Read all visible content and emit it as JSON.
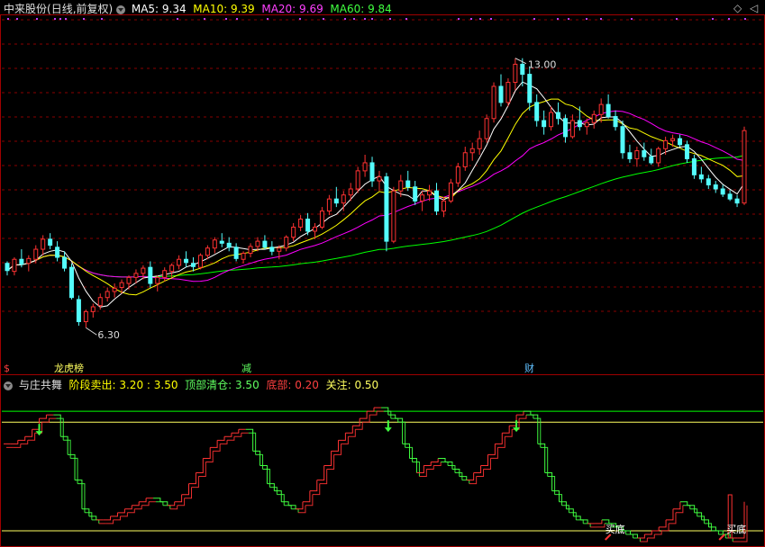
{
  "header": {
    "stock_name": "中来股份",
    "period_label": "(日线,前复权)",
    "ma5_label": "MA5: 9.34",
    "ma10_label": "MA10: 9.39",
    "ma20_label": "MA20: 9.69",
    "ma60_label": "MA60: 9.84",
    "colors": {
      "ma5": "#ffffff",
      "ma10": "#ffff00",
      "ma20": "#ff00ff",
      "ma60": "#00ff00"
    }
  },
  "indicator": {
    "name": "与庄共舞",
    "stage_sell_label": "阶段卖出:",
    "stage_sell_values": "3.20 : 3.50",
    "top_clear_label": "顶部清仓:",
    "top_clear_value": "3.50",
    "bottom_label": "底部:",
    "bottom_value": "0.20",
    "watch_label": "关注:",
    "watch_value": "0.50",
    "buy_bottom_label": "买底"
  },
  "chart_data": [
    {
      "type": "candlestick",
      "title": "中来股份 (日线,前复权)",
      "price_range": [
        5.5,
        14.0
      ],
      "max_label": "13.00",
      "min_label": "6.30",
      "event_markers": [
        {
          "label": "$",
          "color": "#ff4040"
        },
        {
          "label": "龙虎榜",
          "color": "#ffff60"
        },
        {
          "label": "减",
          "color": "#60ff60"
        },
        {
          "label": "财",
          "color": "#60c0ff"
        }
      ],
      "candles": [
        [
          7.9,
          7.95,
          7.6,
          7.72
        ],
        [
          7.7,
          8.05,
          7.6,
          8.0
        ],
        [
          8.0,
          8.25,
          7.8,
          7.88
        ],
        [
          7.9,
          8.1,
          7.7,
          8.02
        ],
        [
          8.0,
          8.35,
          7.9,
          8.25
        ],
        [
          8.25,
          8.6,
          8.1,
          8.5
        ],
        [
          8.5,
          8.65,
          8.25,
          8.35
        ],
        [
          8.3,
          8.45,
          7.95,
          8.05
        ],
        [
          8.05,
          8.2,
          7.7,
          7.78
        ],
        [
          7.8,
          7.9,
          7.0,
          7.05
        ],
        [
          7.0,
          7.1,
          6.35,
          6.45
        ],
        [
          6.45,
          6.75,
          6.3,
          6.7
        ],
        [
          6.7,
          6.9,
          6.55,
          6.82
        ],
        [
          6.85,
          7.15,
          6.75,
          7.05
        ],
        [
          7.05,
          7.3,
          6.95,
          7.2
        ],
        [
          7.2,
          7.4,
          7.05,
          7.28
        ],
        [
          7.3,
          7.5,
          7.15,
          7.42
        ],
        [
          7.4,
          7.6,
          7.25,
          7.55
        ],
        [
          7.55,
          7.75,
          7.4,
          7.65
        ],
        [
          7.65,
          7.85,
          7.5,
          7.78
        ],
        [
          7.8,
          7.95,
          7.3,
          7.4
        ],
        [
          7.4,
          7.6,
          7.2,
          7.55
        ],
        [
          7.55,
          7.8,
          7.45,
          7.72
        ],
        [
          7.7,
          7.9,
          7.55,
          7.85
        ],
        [
          7.85,
          8.1,
          7.75,
          8.0
        ],
        [
          8.0,
          8.2,
          7.8,
          7.92
        ],
        [
          7.9,
          8.05,
          7.7,
          7.82
        ],
        [
          7.8,
          8.15,
          7.75,
          8.1
        ],
        [
          8.1,
          8.35,
          8.0,
          8.28
        ],
        [
          8.28,
          8.55,
          8.15,
          8.48
        ],
        [
          8.45,
          8.65,
          8.3,
          8.4
        ],
        [
          8.4,
          8.55,
          8.2,
          8.3
        ],
        [
          8.3,
          8.4,
          7.95,
          8.02
        ],
        [
          8.0,
          8.2,
          7.9,
          8.15
        ],
        [
          8.15,
          8.4,
          8.05,
          8.32
        ],
        [
          8.32,
          8.55,
          8.2,
          8.45
        ],
        [
          8.45,
          8.6,
          8.25,
          8.3
        ],
        [
          8.3,
          8.45,
          8.1,
          8.2
        ],
        [
          8.2,
          8.35,
          8.0,
          8.28
        ],
        [
          8.28,
          8.6,
          8.2,
          8.55
        ],
        [
          8.55,
          8.9,
          8.45,
          8.8
        ],
        [
          8.8,
          9.1,
          8.7,
          9.0
        ],
        [
          9.0,
          9.15,
          8.6,
          8.7
        ],
        [
          8.7,
          8.9,
          8.5,
          8.8
        ],
        [
          8.8,
          9.3,
          8.75,
          9.2
        ],
        [
          9.2,
          9.6,
          9.1,
          9.5
        ],
        [
          9.5,
          9.8,
          9.3,
          9.4
        ],
        [
          9.4,
          9.7,
          9.2,
          9.6
        ],
        [
          9.6,
          9.9,
          9.45,
          9.75
        ],
        [
          9.75,
          10.3,
          9.65,
          10.2
        ],
        [
          10.2,
          10.6,
          10.05,
          10.4
        ],
        [
          10.4,
          10.55,
          9.8,
          9.95
        ],
        [
          9.95,
          10.2,
          9.7,
          10.05
        ],
        [
          10.05,
          10.15,
          8.2,
          8.45
        ],
        [
          8.45,
          9.8,
          8.4,
          9.7
        ],
        [
          9.7,
          10.1,
          9.55,
          9.95
        ],
        [
          9.95,
          10.2,
          9.7,
          9.8
        ],
        [
          9.8,
          9.95,
          9.35,
          9.45
        ],
        [
          9.45,
          9.7,
          9.2,
          9.6
        ],
        [
          9.6,
          9.85,
          9.45,
          9.7
        ],
        [
          9.7,
          9.9,
          9.1,
          9.2
        ],
        [
          9.2,
          9.55,
          9.05,
          9.45
        ],
        [
          9.45,
          10.0,
          9.4,
          9.9
        ],
        [
          9.9,
          10.4,
          9.8,
          10.3
        ],
        [
          10.3,
          10.8,
          10.2,
          10.65
        ],
        [
          10.65,
          10.9,
          10.45,
          10.75
        ],
        [
          10.75,
          11.2,
          10.6,
          11.0
        ],
        [
          11.0,
          11.6,
          10.9,
          11.5
        ],
        [
          11.5,
          12.4,
          11.4,
          12.3
        ],
        [
          12.3,
          12.6,
          11.8,
          11.9
        ],
        [
          11.9,
          12.5,
          11.8,
          12.4
        ],
        [
          12.4,
          13.0,
          12.2,
          12.85
        ],
        [
          12.85,
          13.0,
          12.3,
          12.6
        ],
        [
          12.6,
          12.8,
          11.7,
          11.9
        ],
        [
          11.9,
          12.1,
          11.3,
          11.45
        ],
        [
          11.45,
          11.7,
          11.1,
          11.3
        ],
        [
          11.3,
          11.8,
          11.2,
          11.65
        ],
        [
          11.65,
          11.9,
          11.35,
          11.5
        ],
        [
          11.5,
          11.6,
          10.9,
          11.05
        ],
        [
          11.05,
          11.6,
          11.0,
          11.45
        ],
        [
          11.45,
          11.8,
          11.2,
          11.3
        ],
        [
          11.3,
          11.5,
          11.1,
          11.4
        ],
        [
          11.4,
          11.7,
          11.25,
          11.6
        ],
        [
          11.6,
          12.0,
          11.4,
          11.85
        ],
        [
          11.85,
          12.1,
          11.5,
          11.55
        ],
        [
          11.55,
          11.7,
          11.2,
          11.3
        ],
        [
          11.3,
          11.45,
          10.5,
          10.65
        ],
        [
          10.65,
          10.85,
          10.4,
          10.5
        ],
        [
          10.5,
          10.8,
          10.3,
          10.7
        ],
        [
          10.7,
          10.9,
          10.45,
          10.55
        ],
        [
          10.55,
          10.75,
          10.35,
          10.4
        ],
        [
          10.4,
          10.8,
          10.3,
          10.75
        ],
        [
          10.75,
          11.05,
          10.6,
          10.95
        ],
        [
          10.95,
          11.1,
          10.8,
          11.0
        ],
        [
          11.0,
          11.1,
          10.8,
          10.85
        ],
        [
          10.85,
          10.95,
          10.4,
          10.5
        ],
        [
          10.5,
          10.6,
          10.0,
          10.1
        ],
        [
          10.1,
          10.3,
          9.9,
          10.0
        ],
        [
          10.0,
          10.1,
          9.75,
          9.85
        ],
        [
          9.85,
          9.95,
          9.65,
          9.75
        ],
        [
          9.75,
          9.85,
          9.55,
          9.62
        ],
        [
          9.62,
          9.72,
          9.45,
          9.5
        ],
        [
          9.5,
          9.6,
          9.3,
          9.4
        ],
        [
          9.4,
          11.3,
          9.35,
          11.2
        ]
      ]
    },
    {
      "type": "step-line",
      "title": "与庄共舞",
      "y_range": [
        0,
        4
      ],
      "reference_lines": [
        3.5,
        3.2,
        0.2
      ],
      "values": [
        2.6,
        2.6,
        2.7,
        2.8,
        3.0,
        3.3,
        3.4,
        3.4,
        2.8,
        2.3,
        1.6,
        0.8,
        0.6,
        0.5,
        0.5,
        0.6,
        0.7,
        0.8,
        0.9,
        1.0,
        1.1,
        1.1,
        1.0,
        0.9,
        1.0,
        1.2,
        1.5,
        1.8,
        2.2,
        2.5,
        2.7,
        2.8,
        2.9,
        3.0,
        3.0,
        2.4,
        2.0,
        1.5,
        1.3,
        1.0,
        0.9,
        0.8,
        1.0,
        1.3,
        1.6,
        2.0,
        2.4,
        2.7,
        2.9,
        3.1,
        3.3,
        3.5,
        3.6,
        3.6,
        3.4,
        3.3,
        2.6,
        2.2,
        1.8,
        2.0,
        2.1,
        2.2,
        2.1,
        1.9,
        1.7,
        1.6,
        1.8,
        2.0,
        2.3,
        2.6,
        2.9,
        3.1,
        3.4,
        3.5,
        3.4,
        2.6,
        1.8,
        1.3,
        1.0,
        0.8,
        0.6,
        0.5,
        0.4,
        0.4,
        0.5,
        0.4,
        0.3,
        0.2,
        0.1,
        0.0,
        0.1,
        0.2,
        0.3,
        0.5,
        0.8,
        1.0,
        0.9,
        0.7,
        0.5,
        0.3,
        0.2,
        0.1,
        0.0,
        0.0,
        1.0
      ],
      "sell_arrow_index": [
        5,
        54,
        72
      ],
      "buy_label_index": [
        86,
        102
      ]
    }
  ]
}
